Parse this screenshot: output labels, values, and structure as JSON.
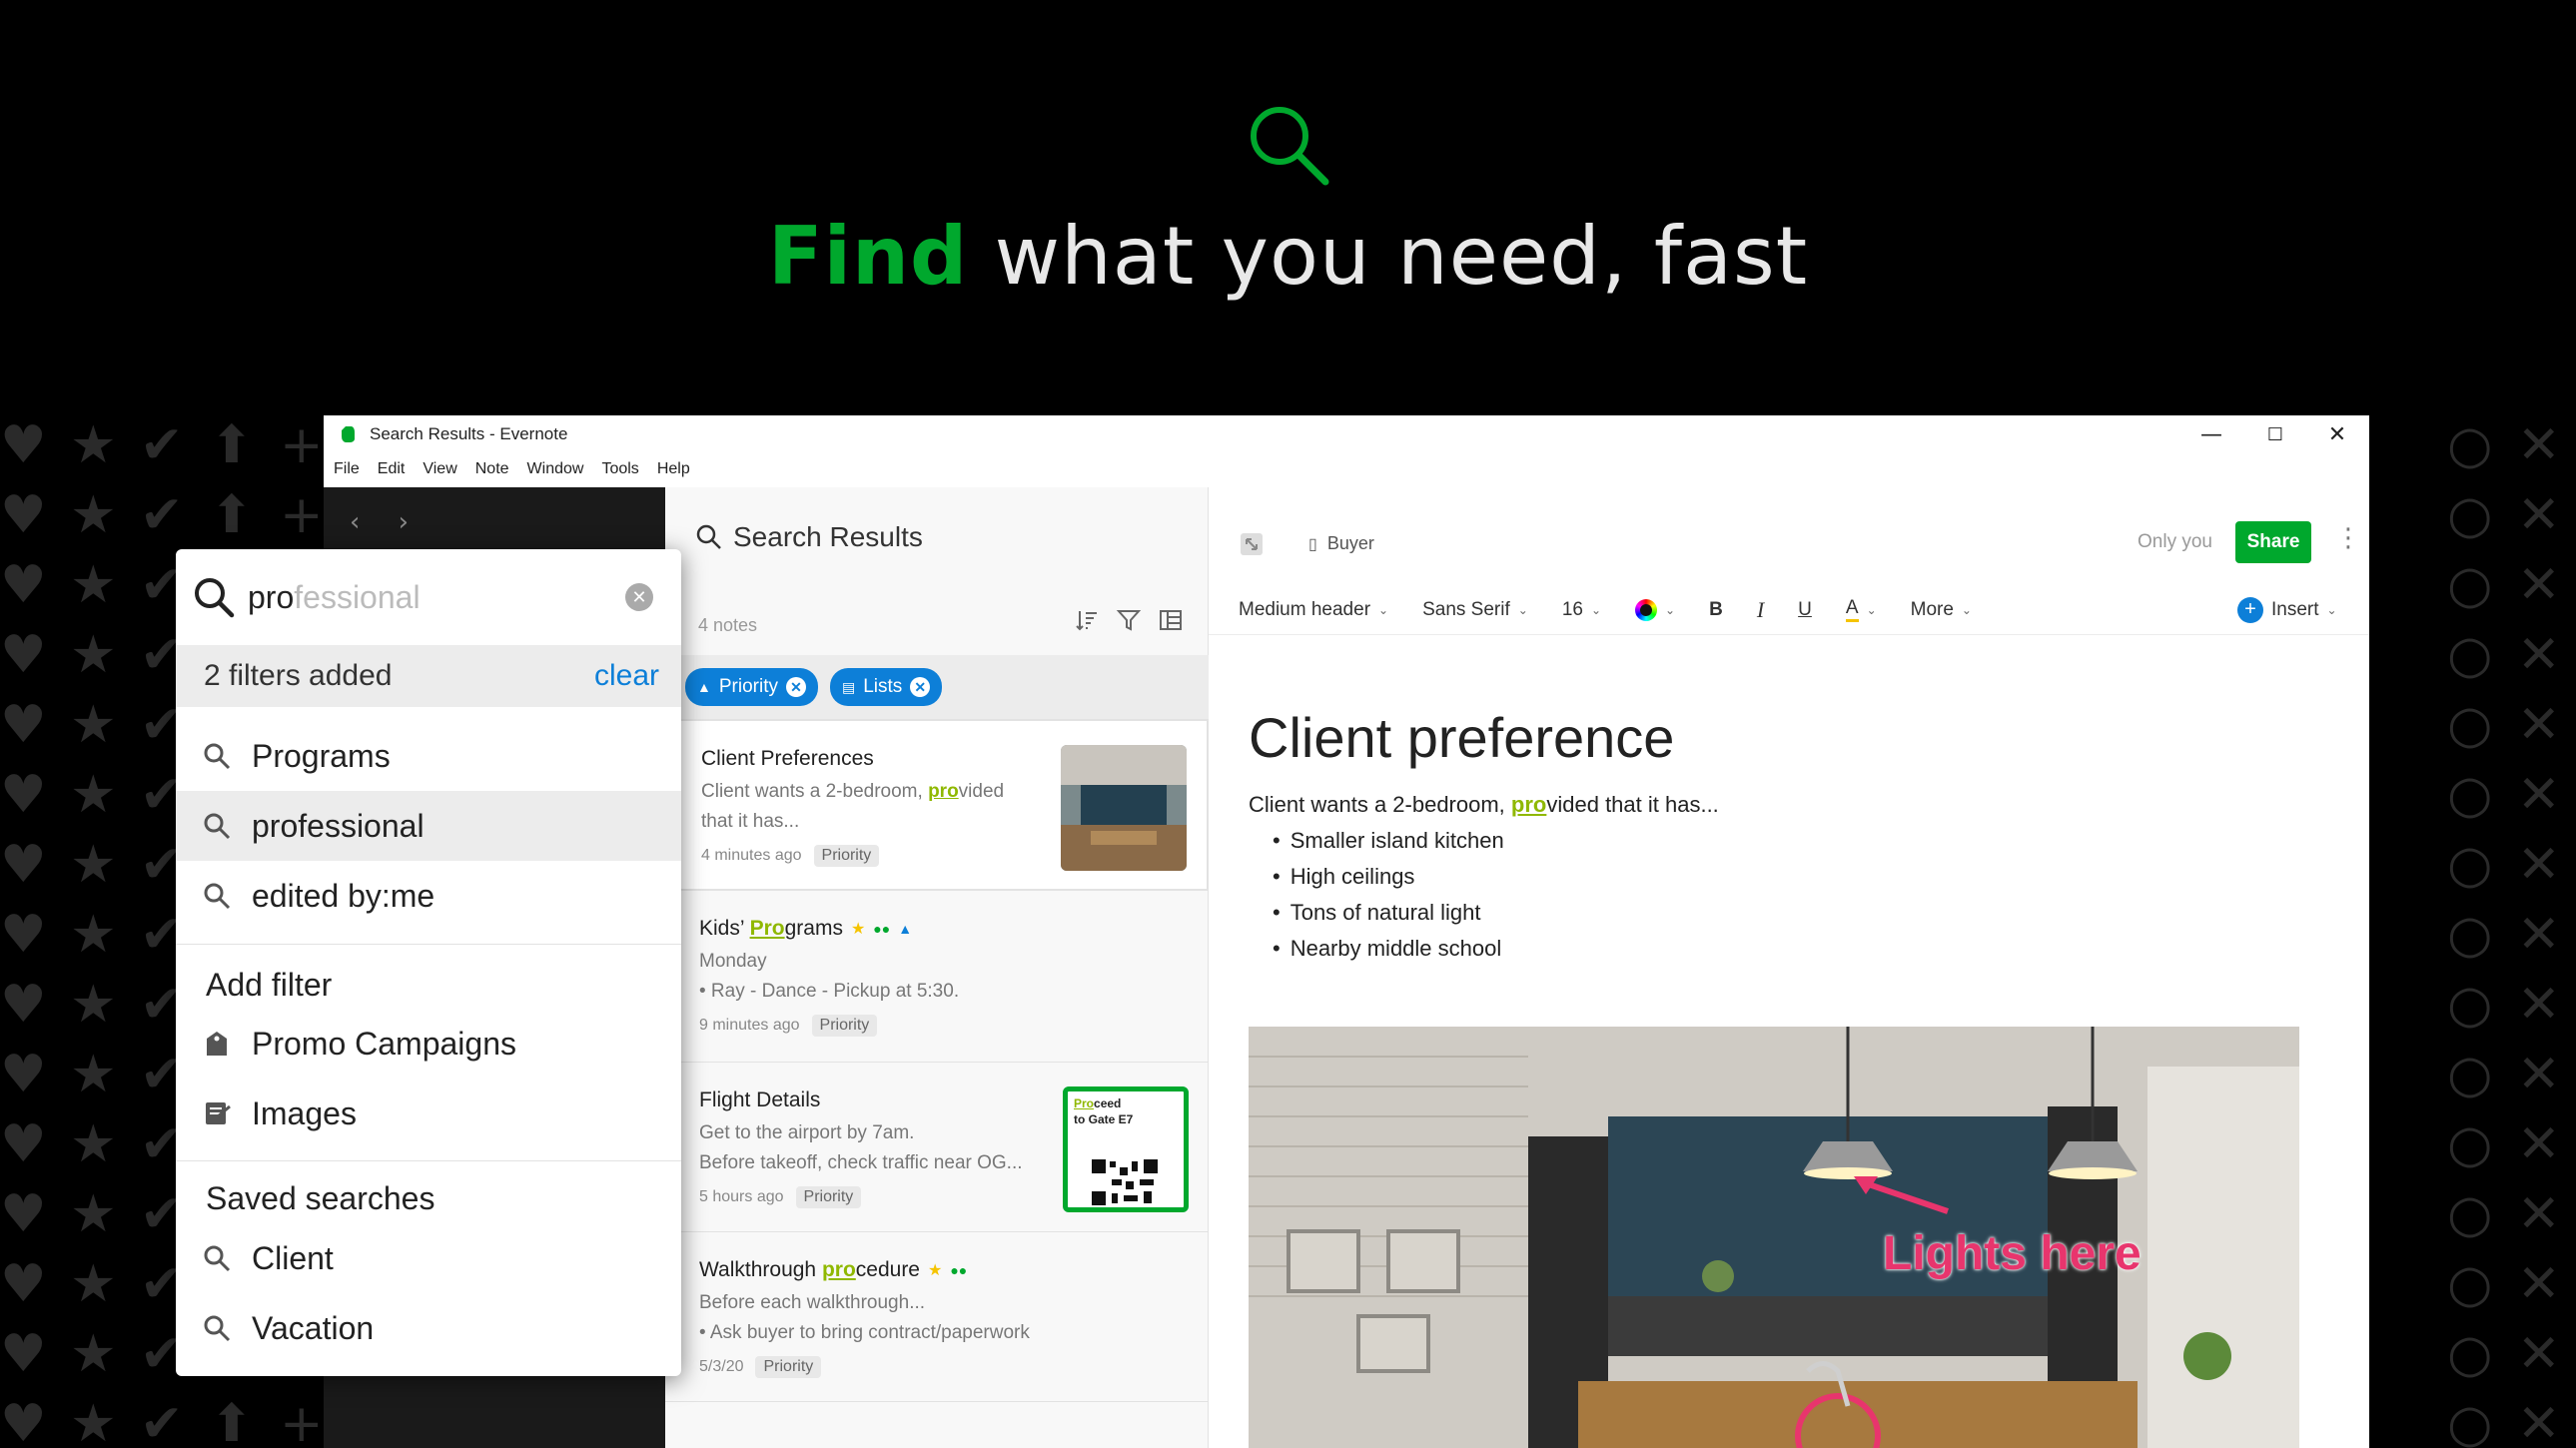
{
  "hero": {
    "title_accent": "Find",
    "title_rest": " what you need, fast"
  },
  "window": {
    "title": "Search Results - Evernote",
    "controls": [
      "—",
      "☐",
      "✕"
    ],
    "menu": [
      "File",
      "Edit",
      "View",
      "Note",
      "Window",
      "Tools",
      "Help"
    ]
  },
  "notelist": {
    "title": "Search Results",
    "count": "4 notes",
    "filters": [
      {
        "label": "Priority",
        "icon": "reminder-icon"
      },
      {
        "label": "Lists",
        "icon": "notebook-icon"
      }
    ],
    "notes": [
      {
        "title": "Client Preferences",
        "body_pre": "Client wants a 2-bedroom, ",
        "body_hl": "pro",
        "body_post": "vided",
        "body2": "that it has...",
        "time": "4 minutes ago",
        "tag": "Priority"
      },
      {
        "title_pre": "Kids’ ",
        "title_hl": "Pro",
        "title_post": "grams",
        "body": "Monday",
        "body2": "• Ray - Dance - Pickup at 5:30.",
        "time": "9 minutes ago",
        "tag": "Priority"
      },
      {
        "title": "Flight Details",
        "body": "Get to the airport by 7am.",
        "body2": "Before takeoff, check traffic near OG...",
        "time": "5 hours ago",
        "tag": "Priority",
        "ticket_hl": "Pro",
        "ticket_rest": "ceed",
        "ticket_line2": "to Gate E7"
      },
      {
        "title_pre": "Walkthrough ",
        "title_hl": "pro",
        "title_post": "cedure",
        "body": "Before each walkthrough...",
        "body2": "• Ask buyer to bring contract/paperwork",
        "time": "5/3/20",
        "tag": "Priority"
      }
    ]
  },
  "editor": {
    "notebook": "Buyer",
    "sharing": "Only you",
    "share_label": "Share",
    "toolbar": {
      "style": "Medium header",
      "font": "Sans Serif",
      "size": "16",
      "more": "More",
      "insert": "Insert"
    },
    "heading": "Client preference",
    "body_pre": "Client wants a 2-bedroom, ",
    "body_hl": "pro",
    "body_post": "vided that it has...",
    "bullets": [
      "Smaller island kitchen",
      "High ceilings",
      "Tons of natural light",
      "Nearby middle school"
    ],
    "image_annotation": "Lights here"
  },
  "search_popup": {
    "typed": "pro",
    "ghost": "fessional",
    "filters_added": "2 filters added",
    "clear_label": "clear",
    "suggestions": [
      "Programs",
      "professional",
      "edited by:me"
    ],
    "add_filter_title": "Add filter",
    "add_filters": [
      {
        "label": "Promo Campaigns",
        "icon": "tag-icon"
      },
      {
        "label": "Images",
        "icon": "image-type-icon"
      }
    ],
    "saved_title": "Saved searches",
    "saved": [
      "Client",
      "Vacation"
    ]
  },
  "colors": {
    "brand_green": "#00a82d",
    "accent_blue": "#0d7fd8",
    "highlight": "#8fb800",
    "annotation": "#e8356d"
  }
}
